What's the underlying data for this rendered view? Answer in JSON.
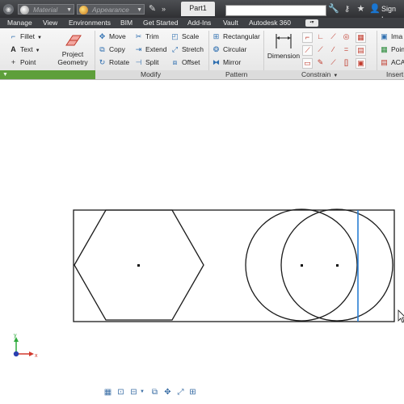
{
  "titlebar": {
    "material_placeholder": "Material",
    "appearance_placeholder": "Appearance",
    "document_tab": "Part1",
    "sign_in_label": "Sign In"
  },
  "menu": {
    "items": [
      "Manage",
      "View",
      "Environments",
      "BIM",
      "Get Started",
      "Add-Ins",
      "Vault",
      "Autodesk 360"
    ]
  },
  "ribbon": {
    "draw": {
      "fillet": "Fillet",
      "text": "Text",
      "point": "Point"
    },
    "project_geometry": [
      "Project",
      "Geometry"
    ],
    "modify": {
      "move": "Move",
      "copy": "Copy",
      "rotate": "Rotate",
      "trim": "Trim",
      "extend": "Extend",
      "split": "Split",
      "scale": "Scale",
      "stretch": "Stretch",
      "offset": "Offset"
    },
    "pattern": {
      "rectangular": "Rectangular",
      "circular": "Circular",
      "mirror": "Mirror"
    },
    "dimension": "Dimension",
    "insert": {
      "image": "Ima",
      "points": "Poin",
      "acad": "ACA"
    },
    "panels": {
      "modify": "Modify",
      "pattern": "Pattern",
      "constrain": "Constrain",
      "insert": "Insert"
    }
  },
  "axis": {
    "x_label": "x",
    "y_label": "y"
  },
  "colors": {
    "titlebar_bg": "#3a3c40",
    "menubar_bg": "#3e4044",
    "ribbon_bg": "#efefef",
    "accent_blue": "#2a7fd4",
    "panel_green": "#5e9f3b"
  }
}
